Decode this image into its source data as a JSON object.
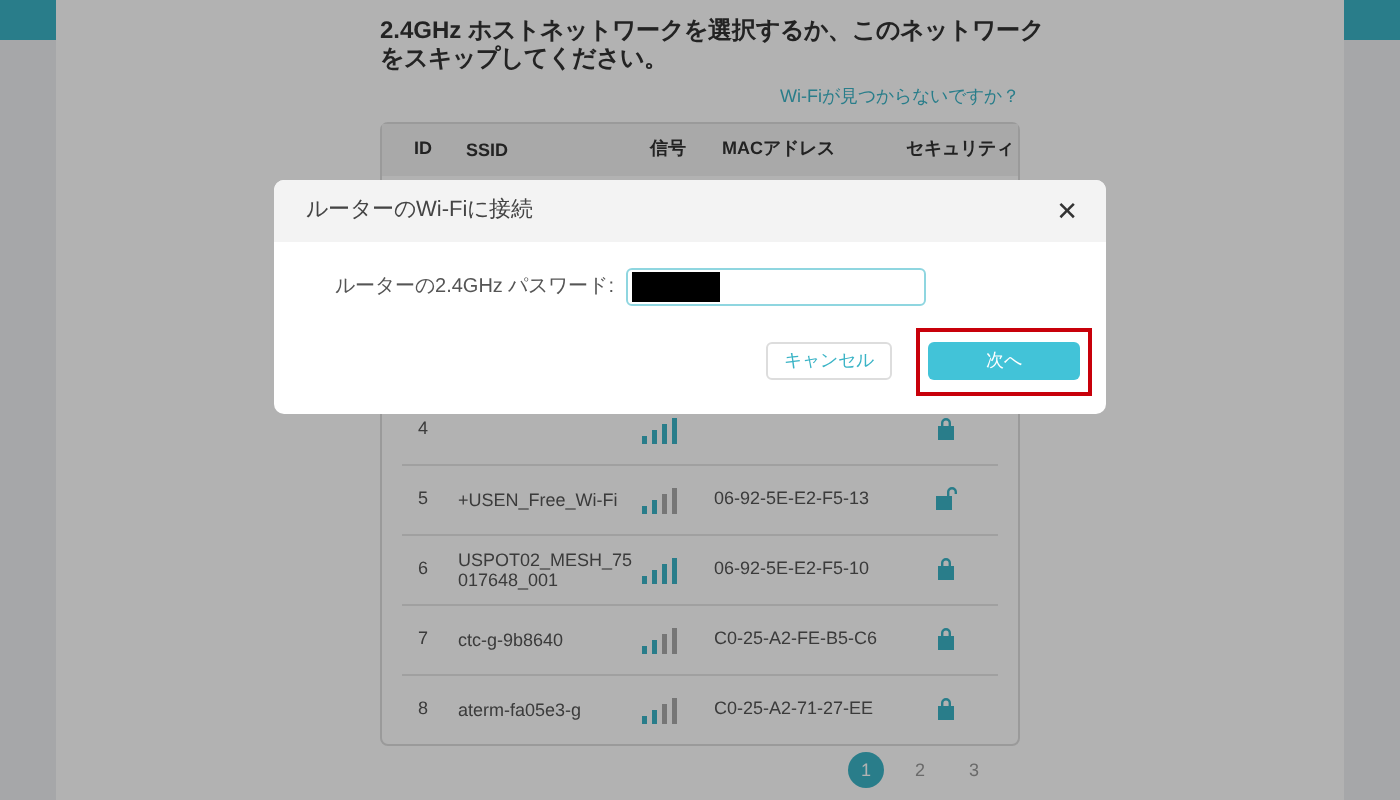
{
  "heading": "2.4GHz ホストネットワークを選択するか、このネットワークをスキップしてください。",
  "help_link": "Wi-Fiが見つからないですか？",
  "table": {
    "columns": [
      "ID",
      "SSID",
      "信号",
      "MACアドレス",
      "セキュリティ"
    ],
    "rows": [
      {
        "id": "4",
        "level": 1,
        "locked": true
      },
      {
        "id": "5",
        "ssid": "+USEN_Free_Wi-Fi",
        "level": 0.5,
        "mac": "06-92-5E-E2-F5-13",
        "locked": false
      },
      {
        "id": "6",
        "ssid": "USPOT02_MESH_75017648_001",
        "level": 1,
        "mac": "06-92-5E-E2-F5-10",
        "locked": true
      },
      {
        "id": "7",
        "ssid": "ctc-g-9b8640",
        "level": 0.5,
        "mac": "C0-25-A2-FE-B5-C6",
        "locked": true
      },
      {
        "id": "8",
        "ssid": "aterm-fa05e3-g",
        "level": 0.5,
        "mac": "C0-25-A2-71-27-EE",
        "locked": true
      }
    ]
  },
  "pagination": [
    {
      "label": "1",
      "selected": true
    },
    {
      "label": "2",
      "selected": false
    },
    {
      "label": "3",
      "selected": false
    }
  ],
  "dialog": {
    "title": "ルーターのWi-Fiに接続",
    "close": "✕",
    "field_label": "ルーターの2.4GHz パスワード:",
    "redacted": true,
    "buttons": [
      {
        "kind": "secondary",
        "label": "キャンセル",
        "highlighted": false
      },
      {
        "kind": "primary",
        "label": "次へ",
        "highlighted": true
      }
    ]
  }
}
